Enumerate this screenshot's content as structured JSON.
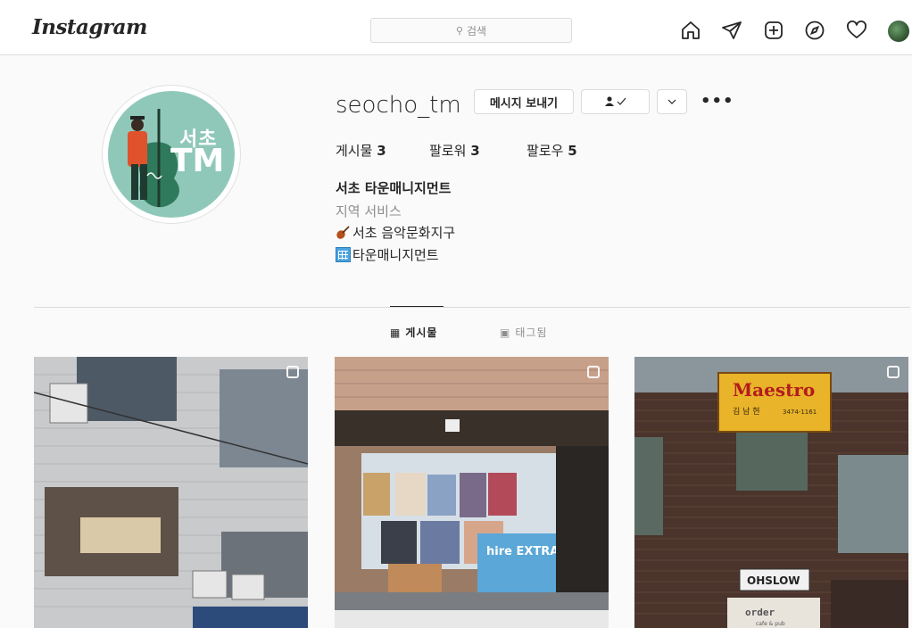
{
  "nav": {
    "logo": "Instagram",
    "search_placeholder": "검색",
    "icons": [
      "home-icon",
      "direct-icon",
      "new-post-icon",
      "explore-icon",
      "activity-heart-icon",
      "profile-avatar"
    ]
  },
  "profile": {
    "username": "seocho_tm",
    "message_button": "메시지 보내기",
    "follow_status_icon": "following-check-icon",
    "dropdown_icon": "chevron-down-icon",
    "more_icon": "•••",
    "avatar_text_top": "서초",
    "avatar_text_bottom": "TM",
    "stats": {
      "posts_label": "게시물",
      "posts_count": "3",
      "followers_label": "팔로워",
      "followers_count": "3",
      "following_label": "팔로우",
      "following_count": "5"
    },
    "bio": {
      "name": "서초 타운매니지먼트",
      "category": "지역 서비스",
      "line1": "서초 음악문화지구",
      "line2": "타운매니지먼트"
    }
  },
  "tabs": [
    {
      "label": "게시물",
      "active": true
    },
    {
      "label": "태그됨",
      "active": false
    }
  ],
  "posts": [
    {
      "description_icon": "multiple-photos-icon"
    },
    {
      "poster_text": "hire EXTRA COLD"
    },
    {
      "sign_text": "Maestro",
      "sign_sub": "김 남 현",
      "sign_phone": "3474-1161",
      "shop_sign": "OHSLOW",
      "shop_sign2": "order",
      "shop_sign3": "cafe & pub"
    }
  ],
  "colors": {
    "background": "#fafafa",
    "border": "#dbdbdb",
    "text": "#262626",
    "muted": "#8e8e8e",
    "avatar_bg": "#8fc8b9"
  }
}
